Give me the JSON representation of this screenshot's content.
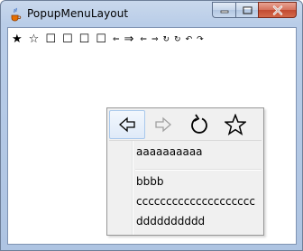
{
  "window": {
    "title": "PopupMenuLayout",
    "icon": "java-cup-icon",
    "controls": [
      "minimize-icon",
      "maximize-icon",
      "close-icon"
    ]
  },
  "toolbar": {
    "glyphs": [
      "★",
      "☆",
      "☐",
      "☐",
      "☐",
      "☐",
      "⇐",
      "⇒",
      "⇐",
      "⇒",
      "↻",
      "↻",
      "↶",
      "↷"
    ]
  },
  "popup": {
    "icons": [
      {
        "name": "back-arrow-icon",
        "glyph": "⇦",
        "enabled": true,
        "selected": true
      },
      {
        "name": "forward-arrow-icon",
        "glyph": "⇨",
        "enabled": false,
        "selected": false
      },
      {
        "name": "reload-icon",
        "glyph": "↻",
        "enabled": true,
        "selected": false
      },
      {
        "name": "star-icon",
        "glyph": "☆",
        "enabled": true,
        "selected": false
      }
    ],
    "items": [
      {
        "label": "aaaaaaaaaa"
      },
      {
        "label": "bbbb"
      },
      {
        "label": "cccccccccccccccccccc"
      },
      {
        "label": "dddddddddd"
      }
    ]
  }
}
